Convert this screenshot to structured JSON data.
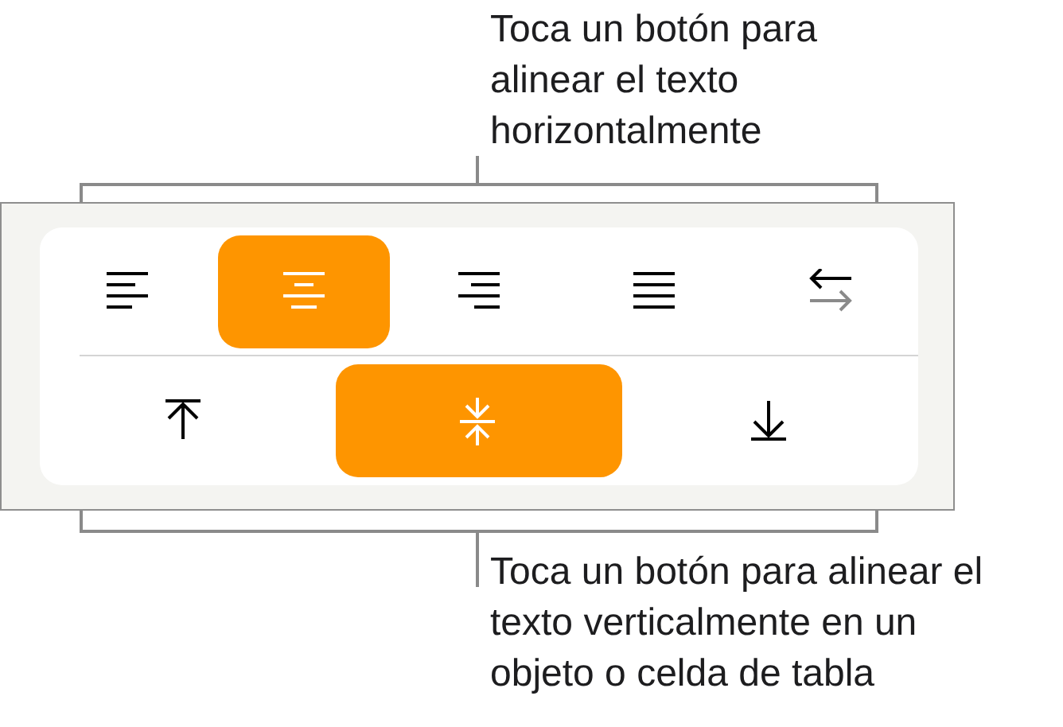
{
  "callouts": [
    {
      "text": "Toca un botón para alinear el texto horizontalmente"
    },
    {
      "text": "Toca un botón para alinear el texto verticalmente en un objeto o celda de tabla"
    }
  ],
  "horizontal_alignment": [
    {
      "kind": "left",
      "selected": false
    },
    {
      "kind": "center",
      "selected": true
    },
    {
      "kind": "right",
      "selected": false
    },
    {
      "kind": "justify",
      "selected": false
    },
    {
      "kind": "direction",
      "selected": false
    }
  ],
  "vertical_alignment": [
    {
      "kind": "top",
      "selected": false
    },
    {
      "kind": "middle",
      "selected": true
    },
    {
      "kind": "bottom",
      "selected": false
    }
  ]
}
